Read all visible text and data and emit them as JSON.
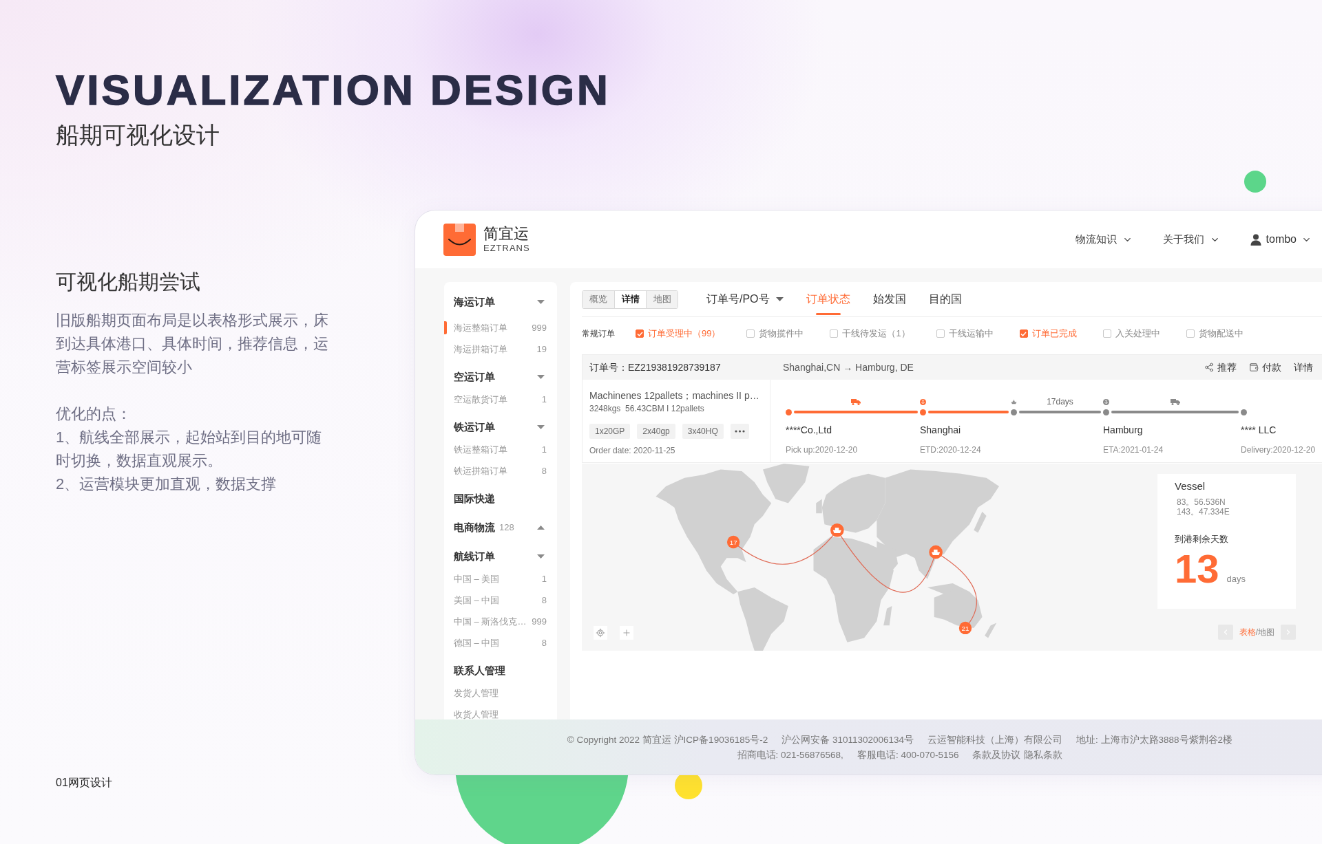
{
  "page": {
    "title": "VISUALIZATION DESIGN",
    "subtitle": "船期可视化设计",
    "section_title": "可视化船期尝试",
    "description": "旧版船期页面布局是以表格形式展示，床到达具体港口、具体时间，推荐信息，运营标签展示空间较小",
    "points_title": "优化的点：",
    "points": [
      "1、航线全部展示，起始站到目的地可随时切换，数据直观展示。",
      "2、运营模块更加直观，数据支撑"
    ],
    "page_label": "01网页设计"
  },
  "app": {
    "brand": {
      "name": "简宜运",
      "tagline": "EZTRANS"
    },
    "nav": [
      {
        "kind": "menu",
        "label": "物流知识"
      },
      {
        "kind": "menu",
        "label": "关于我们"
      },
      {
        "kind": "user",
        "label": "tombo"
      }
    ],
    "sidebar": {
      "groups": [
        {
          "kind": "section",
          "label": "海运订单",
          "expanded": true,
          "items": [
            {
              "label": "海运整箱订单",
              "count": "999",
              "selected": true
            },
            {
              "label": "海运拼箱订单",
              "count": "19",
              "selected": false
            }
          ]
        },
        {
          "kind": "section",
          "label": "空运订单",
          "expanded": true,
          "items": [
            {
              "label": "空运散货订单",
              "count": "1",
              "selected": false
            }
          ]
        },
        {
          "kind": "section",
          "label": "铁运订单",
          "expanded": true,
          "items": [
            {
              "label": "铁运整箱订单",
              "count": "1",
              "selected": false
            },
            {
              "label": "铁运拼箱订单",
              "count": "8",
              "selected": false
            }
          ]
        },
        {
          "kind": "plain",
          "label": "国际快递"
        },
        {
          "kind": "section",
          "label": "电商物流",
          "count": "128",
          "expanded": false
        },
        {
          "kind": "section",
          "label": "航线订单",
          "expanded": true,
          "items": [
            {
              "label": "中国 – 美国",
              "count": "1",
              "selected": false
            },
            {
              "label": "美国 – 中国",
              "count": "8",
              "selected": false
            },
            {
              "label": "中国 – 斯洛伐克…",
              "count": "999",
              "selected": false
            },
            {
              "label": "德国 – 中国",
              "count": "8",
              "selected": false
            }
          ]
        },
        {
          "kind": "plain",
          "label": "联系人管理",
          "items": [
            {
              "label": "发货人管理",
              "selected": false
            },
            {
              "label": "收货人管理",
              "selected": false
            }
          ]
        }
      ]
    },
    "view_switch": [
      {
        "label": "概览",
        "selected": false
      },
      {
        "label": "详情",
        "selected": true
      },
      {
        "label": "地图",
        "selected": false
      }
    ],
    "tabs": [
      {
        "kind": "dropdown",
        "label": "订单号/PO号",
        "selected": false
      },
      {
        "kind": "tab",
        "label": "订单状态",
        "selected": true
      },
      {
        "kind": "tab",
        "label": "始发国",
        "selected": false
      },
      {
        "kind": "tab",
        "label": "目的国",
        "selected": false
      }
    ],
    "filter_label": "常规订单",
    "filters": [
      {
        "label": "订单受理中（99）",
        "checked": true
      },
      {
        "label": "货物揽件中",
        "checked": false
      },
      {
        "label": "干线待发运（1）",
        "checked": false
      },
      {
        "label": "干线运输中",
        "checked": false
      },
      {
        "label": "订单已完成",
        "checked": true
      },
      {
        "label": "入关处理中",
        "checked": false
      },
      {
        "label": "货物配送中",
        "checked": false
      }
    ],
    "order": {
      "number": "订单号：EZ219381928739187",
      "route": "Shanghai,CN → Hamburg, DE",
      "actions": [
        {
          "kind": "recommend",
          "label": "推荐"
        },
        {
          "kind": "pay",
          "label": "付款"
        },
        {
          "kind": "details",
          "label": "详情"
        }
      ],
      "cargo": "Machinenes 12pallets；machines II p…",
      "metrics": "3248kgs  56.43CBM I 12pallets",
      "containers": [
        "1x20GP",
        "2x40gp",
        "3x40HQ"
      ],
      "order_date": "Order date: 2020-11-25",
      "timeline": {
        "stops": [
          {
            "kind": "origin",
            "name": "****Co.,Ltd",
            "date": "Pick up:2020-12-20",
            "reached": true
          },
          {
            "kind": "port",
            "name": "Shanghai",
            "date": "ETD:2020-12-24",
            "reached": true
          },
          {
            "kind": "vessel",
            "reached": false
          },
          {
            "kind": "port",
            "name": "Hamburg",
            "date": "ETA:2021-01-24",
            "reached": false
          },
          {
            "kind": "destination",
            "name": "**** LLC",
            "date": "Delivery:2020-12-20",
            "reached": false
          }
        ],
        "legs": [
          {
            "kind": "truck",
            "done": true
          },
          {
            "kind": "plain",
            "done": true
          },
          {
            "kind": "sea",
            "label": "17days",
            "done": false
          },
          {
            "kind": "truck",
            "done": false
          }
        ]
      }
    },
    "map": {
      "markers": [
        {
          "kind": "count",
          "label": "17"
        },
        {
          "kind": "ship"
        },
        {
          "kind": "ship"
        },
        {
          "kind": "count",
          "label": "21"
        }
      ],
      "vessel": {
        "title": "Vessel",
        "latitude": "83。56.536N",
        "longitude": "143。47.334E",
        "eta_label": "到港剩余天数",
        "days": "13",
        "unit": "days"
      },
      "view_toggle": {
        "options": [
          {
            "label": "表格",
            "selected": true
          },
          {
            "label": "地图",
            "selected": false
          }
        ],
        "separator": "/"
      }
    },
    "footer": {
      "lines": [
        [
          {
            "kind": "text",
            "text": "© Copyright 2022 简宜运 沪ICP备19036185号-2"
          },
          {
            "kind": "text",
            "text": "沪公网安备 31011302006134号"
          },
          {
            "kind": "text",
            "text": "云运智能科技（上海）有限公司"
          },
          {
            "kind": "text",
            "text": "地址: 上海市沪太路3888号紫荆谷2楼"
          }
        ],
        [
          {
            "kind": "text",
            "text": "招商电话: 021-56876568,"
          },
          {
            "kind": "text",
            "text": "客服电话: 400-070-5156"
          },
          {
            "kind": "link",
            "text": "条款及协议"
          },
          {
            "kind": "link",
            "text": "隐私条款"
          }
        ]
      ]
    }
  }
}
